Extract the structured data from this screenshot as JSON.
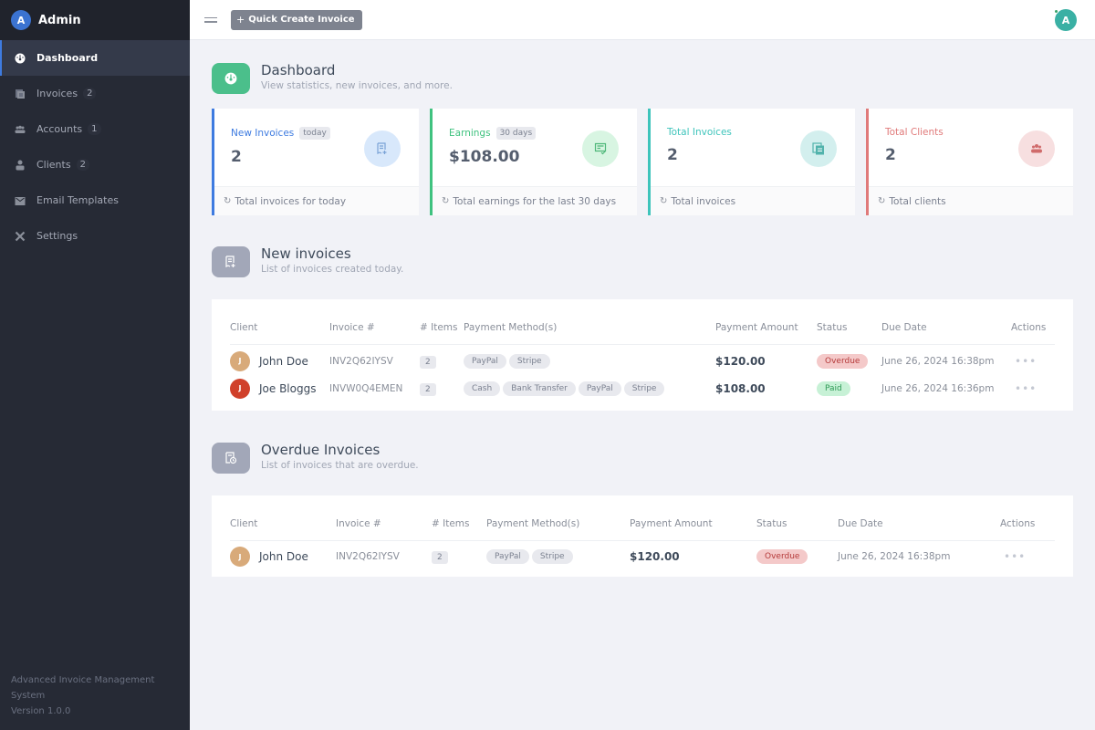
{
  "brand": {
    "avatar_letter": "A",
    "name": "Admin"
  },
  "sidebar": {
    "items": [
      {
        "label": "Dashboard",
        "icon": "dashboard-icon",
        "active": true,
        "badge": null
      },
      {
        "label": "Invoices",
        "icon": "invoices-icon",
        "badge": "2"
      },
      {
        "label": "Accounts",
        "icon": "accounts-icon",
        "badge": "1"
      },
      {
        "label": "Clients",
        "icon": "clients-icon",
        "badge": "2"
      },
      {
        "label": "Email Templates",
        "icon": "email-icon",
        "badge": null
      },
      {
        "label": "Settings",
        "icon": "settings-icon",
        "badge": null
      }
    ],
    "footer": {
      "app_name": "Advanced Invoice Management System",
      "version": "Version 1.0.0"
    }
  },
  "topbar": {
    "quick_create_label": "Quick Create Invoice",
    "plus": "+",
    "user_avatar_letter": "A"
  },
  "dashboard": {
    "title": "Dashboard",
    "subtitle": "View statistics, new invoices, and more.",
    "icon_color": "#4bbf8b"
  },
  "stats": [
    {
      "title": "New Invoices",
      "tag": "today",
      "value": "2",
      "footer": "Total invoices for today",
      "accent": "#3e7be0",
      "circle_bg": "#d8e8fb",
      "icon_color": "#7aa3d6"
    },
    {
      "title": "Earnings",
      "tag": "30 days",
      "value": "$108.00",
      "footer": "Total earnings for the last 30 days",
      "accent": "#3fc27f",
      "circle_bg": "#d8f5e2",
      "icon_color": "#4fb87a"
    },
    {
      "title": "Total Invoices",
      "tag": null,
      "value": "2",
      "footer": "Total invoices",
      "accent": "#3ec4bb",
      "circle_bg": "#d3efee",
      "icon_color": "#52b3ac"
    },
    {
      "title": "Total Clients",
      "tag": null,
      "value": "2",
      "footer": "Total clients",
      "accent": "#e07a7a",
      "circle_bg": "#f7dfe0",
      "icon_color": "#d06b6b"
    }
  ],
  "new_invoices": {
    "title": "New invoices",
    "subtitle": "List of invoices created today.",
    "columns": [
      "Client",
      "Invoice #",
      "# Items",
      "Payment Method(s)",
      "Payment Amount",
      "Status",
      "Due Date",
      "Actions"
    ],
    "rows": [
      {
        "client": "John Doe",
        "initial": "J",
        "avatar_color": "#d8aa7a",
        "invoice": "INV2Q62IYSV",
        "items": "2",
        "methods": [
          "PayPal",
          "Stripe"
        ],
        "amount": "$120.00",
        "status": "Overdue",
        "status_kind": "overdue",
        "due": "June 26, 2024 16:38pm",
        "actions": "•••"
      },
      {
        "client": "Joe Bloggs",
        "initial": "J",
        "avatar_color": "#d0402a",
        "invoice": "INVW0Q4EMEN",
        "items": "2",
        "methods": [
          "Cash",
          "Bank Transfer",
          "PayPal",
          "Stripe"
        ],
        "amount": "$108.00",
        "status": "Paid",
        "status_kind": "paid",
        "due": "June 26, 2024 16:36pm",
        "actions": "•••"
      }
    ]
  },
  "overdue_invoices": {
    "title": "Overdue Invoices",
    "subtitle": "List of invoices that are overdue.",
    "columns": [
      "Client",
      "Invoice #",
      "# Items",
      "Payment Method(s)",
      "Payment Amount",
      "Status",
      "Due Date",
      "Actions"
    ],
    "rows": [
      {
        "client": "John Doe",
        "initial": "J",
        "avatar_color": "#d8aa7a",
        "invoice": "INV2Q62IYSV",
        "items": "2",
        "methods": [
          "PayPal",
          "Stripe"
        ],
        "amount": "$120.00",
        "status": "Overdue",
        "status_kind": "overdue",
        "due": "June 26, 2024 16:38pm",
        "actions": "•••"
      }
    ]
  }
}
